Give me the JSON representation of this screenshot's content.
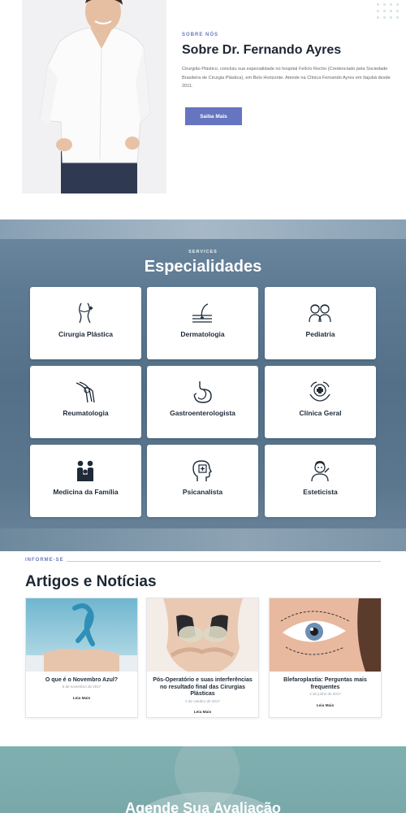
{
  "about": {
    "eyebrow": "SOBRE NÓS",
    "title": "Sobre Dr. Fernando Ayres",
    "text": "Cirurgião Plástico, concluiu sua especialidade no hospital Felício Rocho (Credenciado pela Sociedade Brasileira de Cirurgia Plástica), em Belo Horizonte. Atende na Clínica Fernando Ayres em Itajubá desde 2011.",
    "button": "Saiba Mais"
  },
  "services": {
    "eyebrow": "SERVICES",
    "title": "Especialidades",
    "items": [
      {
        "label": "Cirurgia Plástica",
        "icon": "body-contour-icon"
      },
      {
        "label": "Dermatologia",
        "icon": "skin-hair-icon"
      },
      {
        "label": "Pediatria",
        "icon": "children-icon"
      },
      {
        "label": "Reumatologia",
        "icon": "joint-bones-icon"
      },
      {
        "label": "Gastroenterologista",
        "icon": "stomach-icon"
      },
      {
        "label": "Clínica Geral",
        "icon": "medical-cross-hands-icon"
      },
      {
        "label": "Medicina da Família",
        "icon": "family-icon"
      },
      {
        "label": "Psicanalista",
        "icon": "head-mind-icon"
      },
      {
        "label": "Esteticista",
        "icon": "beautician-icon"
      }
    ]
  },
  "news": {
    "eyebrow": "INFORME-SE",
    "title": "Artigos e Notícias",
    "articles": [
      {
        "title": "O que é o Novembro Azul?",
        "date": "6 de novembro de 2017",
        "read": "Leia Mais"
      },
      {
        "title": "Pós-Operatório e suas interferências no resultado final das Cirurgias Plásticas",
        "date": "2 de outubro de 2017",
        "read": "Leia Mais"
      },
      {
        "title": "Blefaroplastia: Perguntas mais frequentes",
        "date": "4 de junho de 2017",
        "read": "Leia Mais"
      }
    ]
  },
  "cta": {
    "title": "Agende Sua Avaliação"
  },
  "colors": {
    "accent": "#6575c0",
    "services_bg": "#537088",
    "cta_bg": "#7fb0b0"
  }
}
